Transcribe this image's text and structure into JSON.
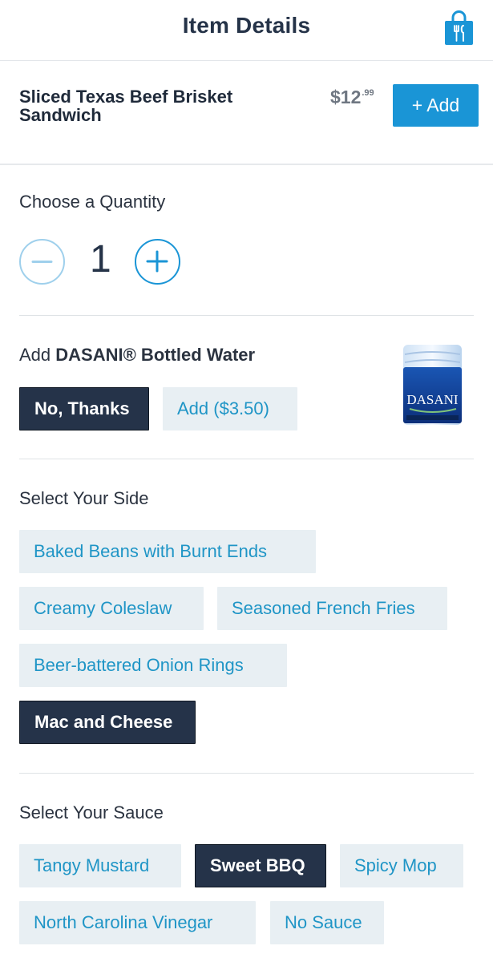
{
  "header": {
    "title": "Item Details",
    "bag_icon": "shopping-bag-fork-knife-icon"
  },
  "item": {
    "name": "Sliced Texas Beef Brisket Sandwich",
    "price_dollars": "$12",
    "price_cents": ".99",
    "add_label": "+ Add"
  },
  "quantity": {
    "label": "Choose a Quantity",
    "value": "1",
    "minus_icon": "minus-circle-icon",
    "plus_icon": "plus-circle-icon"
  },
  "water": {
    "label_prefix": "Add ",
    "label_bold": "DASANI® Bottled Water",
    "options": [
      "No, Thanks",
      "Add ($3.50)"
    ],
    "selected": "No, Thanks",
    "image_text": "DASANI"
  },
  "side": {
    "label": "Select Your Side",
    "options": [
      "Baked Beans with Burnt Ends",
      "Creamy Coleslaw",
      "Seasoned French Fries",
      "Beer-battered Onion Rings",
      "Mac and Cheese"
    ],
    "selected": "Mac and Cheese"
  },
  "sauce": {
    "label": "Select Your Sauce",
    "options": [
      "Tangy Mustard",
      "Sweet BBQ",
      "Spicy Mop",
      "North Carolina Vinegar",
      "No Sauce"
    ],
    "selected": "Sweet BBQ"
  },
  "colors": {
    "accent": "#1a95d6",
    "selected_chip": "#253349",
    "chip_bg": "#e8eff3",
    "chip_text": "#1f95c6"
  }
}
